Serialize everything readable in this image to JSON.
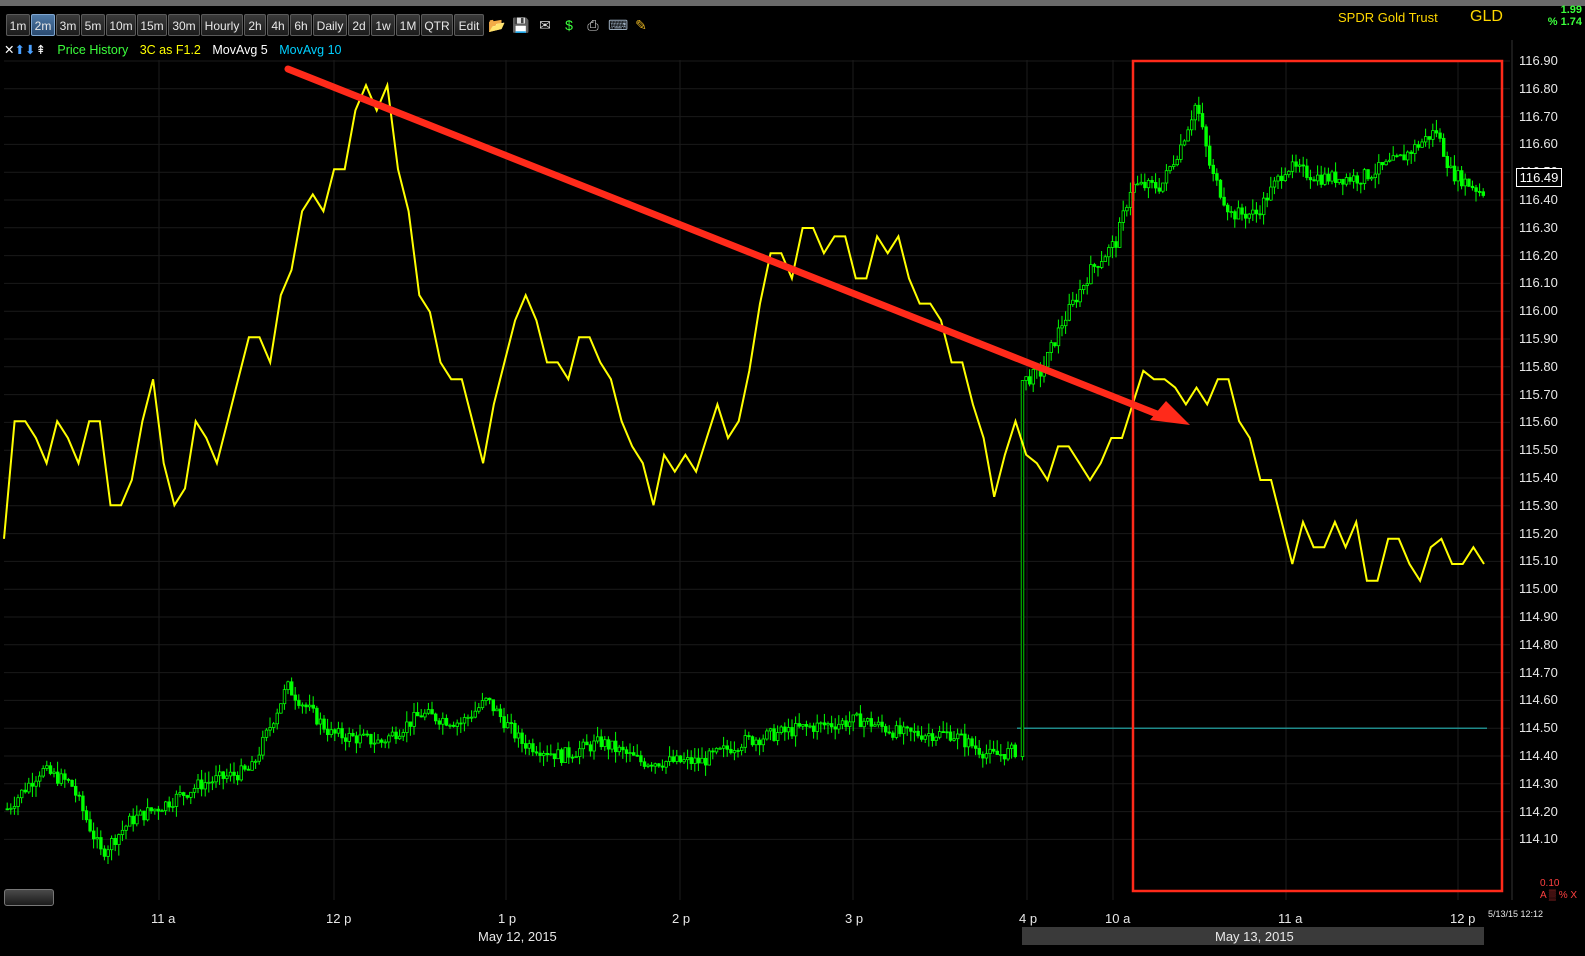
{
  "toolbar": {
    "intervals": [
      "1m",
      "2m",
      "3m",
      "5m",
      "10m",
      "15m",
      "30m",
      "Hourly",
      "2h",
      "4h",
      "6h",
      "Daily",
      "2d",
      "1w",
      "1M",
      "QTR",
      "Edit"
    ],
    "active_interval": "2m",
    "icons": [
      "folder-icon",
      "save-icon",
      "mail-icon",
      "dollar-icon",
      "print-icon",
      "keyboard-icon",
      "pencil-icon"
    ]
  },
  "header": {
    "security_name": "SPDR Gold Trust",
    "symbol": "GLD",
    "change": "1.99",
    "change_pct": "% 1.74"
  },
  "legend": {
    "price_history": "Price History",
    "indicator": "3C as F1.2",
    "mavg5": "MovAvg 5",
    "mavg10": "MovAvg 10"
  },
  "colors": {
    "indicator_line": "#ffff00",
    "candle": "#00ff00",
    "arrow": "#ff2a1a",
    "highlight_box": "#ff2a1a",
    "baseline": "#1f8a8a"
  },
  "yaxis": {
    "ticks": [
      "116.90",
      "116.80",
      "116.70",
      "116.60",
      "116.50",
      "116.40",
      "116.30",
      "116.20",
      "116.10",
      "116.00",
      "115.90",
      "115.80",
      "115.70",
      "115.60",
      "115.50",
      "115.40",
      "115.30",
      "115.20",
      "115.10",
      "115.00",
      "114.90",
      "114.80",
      "114.70",
      "114.60",
      "114.50",
      "114.40",
      "114.30",
      "114.20",
      "114.10"
    ],
    "last_price": "116.49"
  },
  "xaxis": {
    "ticks": [
      "11 a",
      "12 p",
      "1 p",
      "2 p",
      "3 p",
      "4 p",
      "10 a",
      "11 a",
      "12 p"
    ],
    "dates": [
      "May 12, 2015",
      "May 13, 2015"
    ]
  },
  "timestamp": "5/13/15 12:12",
  "scale_note": "0.10",
  "scale_letters": "A ▒ % X",
  "chart_data": {
    "type": "line",
    "price_range": [
      114.1,
      116.9
    ],
    "indicator_series": {
      "name": "3C as F1.2",
      "normalized": [
        0.43,
        0.57,
        0.57,
        0.55,
        0.52,
        0.57,
        0.55,
        0.52,
        0.57,
        0.57,
        0.47,
        0.47,
        0.5,
        0.57,
        0.62,
        0.52,
        0.47,
        0.49,
        0.57,
        0.55,
        0.52,
        0.57,
        0.62,
        0.67,
        0.67,
        0.64,
        0.72,
        0.75,
        0.82,
        0.84,
        0.82,
        0.87,
        0.87,
        0.94,
        0.97,
        0.94,
        0.97,
        0.87,
        0.82,
        0.72,
        0.7,
        0.64,
        0.62,
        0.62,
        0.57,
        0.52,
        0.59,
        0.64,
        0.69,
        0.72,
        0.69,
        0.64,
        0.64,
        0.62,
        0.67,
        0.67,
        0.64,
        0.62,
        0.57,
        0.54,
        0.52,
        0.47,
        0.53,
        0.51,
        0.53,
        0.51,
        0.55,
        0.59,
        0.55,
        0.57,
        0.63,
        0.71,
        0.77,
        0.77,
        0.74,
        0.8,
        0.8,
        0.77,
        0.79,
        0.79,
        0.74,
        0.74,
        0.79,
        0.77,
        0.79,
        0.74,
        0.71,
        0.71,
        0.69,
        0.64,
        0.64,
        0.59,
        0.55,
        0.48,
        0.53,
        0.57,
        0.53,
        0.52,
        0.5,
        0.54,
        0.54,
        0.52,
        0.5,
        0.52,
        0.55,
        0.55,
        0.59,
        0.63,
        0.62,
        0.62,
        0.61,
        0.59,
        0.61,
        0.59,
        0.62,
        0.62,
        0.57,
        0.55,
        0.5,
        0.5,
        0.45,
        0.4,
        0.45,
        0.42,
        0.42,
        0.45,
        0.42,
        0.45,
        0.38,
        0.38,
        0.43,
        0.43,
        0.4,
        0.38,
        0.42,
        0.43,
        0.4,
        0.4,
        0.42,
        0.4
      ]
    }
  }
}
